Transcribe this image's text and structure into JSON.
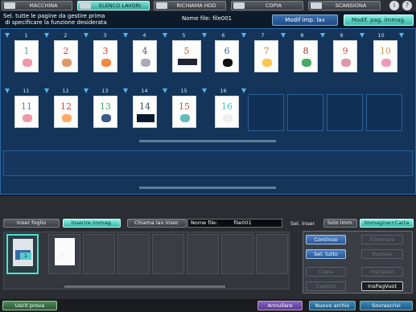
{
  "tabs": [
    {
      "label": "MACCHINA",
      "active": false
    },
    {
      "label": "ELENCO LAVORI",
      "active": true
    },
    {
      "label": "RICHIAMA HDD",
      "active": false
    },
    {
      "label": "COPIA",
      "active": false
    },
    {
      "label": "SCANSIONA",
      "active": false
    }
  ],
  "header": {
    "instruction_line1": "Sel. tutte le pagine da gestire prima",
    "instruction_line2": " di specificare la funzione desiderata",
    "file_name": "Nome file: file001",
    "modif_imp_lav": "Modif imp. lav",
    "modif_pag_immag": "Modif. pag. immag."
  },
  "pages": [
    "1",
    "2",
    "3",
    "4",
    "5",
    "6",
    "7",
    "8",
    "9",
    "10",
    "11",
    "12",
    "13",
    "14",
    "15",
    "16"
  ],
  "lower_tabs": {
    "inser_foglio": "Inser foglio",
    "inserire_immag": "Inserire immag.",
    "chiama_lav_inser": "Chiama lav inser.",
    "nome_file_label": "Nome file:",
    "nome_file_value": "file001",
    "sel_inser": "Sel. Inser",
    "solo_imm": "Solo imm.",
    "immagine_carta": "Immagine+Carta"
  },
  "insert_thumbs": [
    "1",
    "2"
  ],
  "right_panel": {
    "continuo": "Continuo",
    "eliminare": "Eliminare",
    "sel_tutto": "Sel. tutto",
    "ruotare": "Ruotare",
    "copia": "Copia",
    "ins_spost": "Ins/Spost",
    "capitoli": "Capitoli",
    "ins_pag_vuot": "InsPagVuot"
  },
  "footer": {
    "uscit_prova": "Uscit prova",
    "annullare": "Annullare",
    "nuovo_archiv": "Nuovo archiv",
    "sovrascrivi": "Sovrascrivi"
  },
  "colors": {
    "accent_teal": "#3ab5a8",
    "accent_blue": "#2a5796",
    "page_area_bg": "#14345a"
  }
}
